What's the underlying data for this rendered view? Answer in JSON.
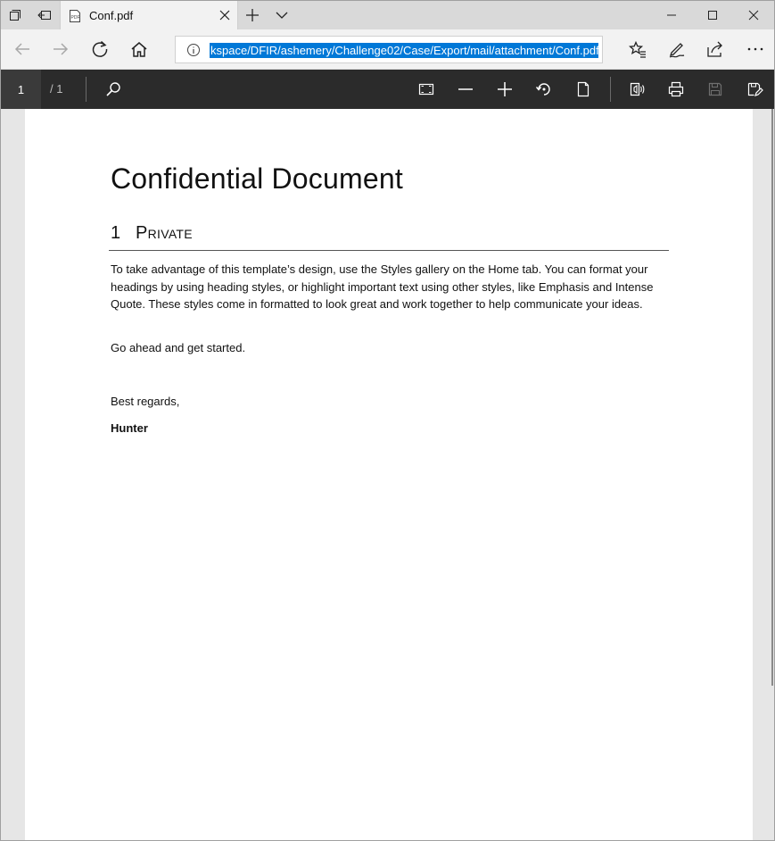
{
  "browser": {
    "tab": {
      "title": "Conf.pdf",
      "favicon": "pdf-file-icon"
    },
    "address": {
      "url": "kspace/DFIR/ashemery/Challenge02/Case/Export/mail/attachment/Conf.pdf"
    },
    "icons": {
      "set_tabs_aside": "tabs-aside-icon",
      "back_to_tabs": "tabs-back-icon",
      "new_tab": "plus-icon",
      "tab_list": "chevron-down-icon",
      "minimize": "minimize-icon",
      "maximize": "maximize-icon",
      "close": "close-icon",
      "back": "back-arrow-icon",
      "forward": "forward-arrow-icon",
      "refresh": "refresh-icon",
      "home": "home-icon",
      "site_info": "info-icon",
      "favorites": "favorites-star-icon",
      "notes": "pen-icon",
      "share": "share-icon",
      "more": "more-icon"
    }
  },
  "pdf_toolbar": {
    "current_page": "1",
    "total_pages": "/ 1",
    "icons": [
      "search-icon",
      "fit-page-icon",
      "zoom-out-icon",
      "zoom-in-icon",
      "rotate-icon",
      "page-layout-icon",
      "read-aloud-icon",
      "print-icon",
      "save-icon",
      "save-as-icon"
    ]
  },
  "document": {
    "title": "Confidential Document",
    "heading": {
      "number": "1",
      "label": "Private"
    },
    "paragraph": "To take advantage of this template’s design, use the Styles gallery on the Home tab. You can format your headings by using heading styles, or highlight important text using other styles, like Emphasis and Intense Quote. These styles come in formatted to look great and work together to help communicate your ideas.",
    "line2": "Go ahead and get started.",
    "closing": "Best regards,",
    "signature": "Hunter"
  },
  "colors": {
    "selection": "#0078d7",
    "pdf_toolbar_bg": "#2b2b2b",
    "chrome_bg": "#f2f2f2"
  }
}
